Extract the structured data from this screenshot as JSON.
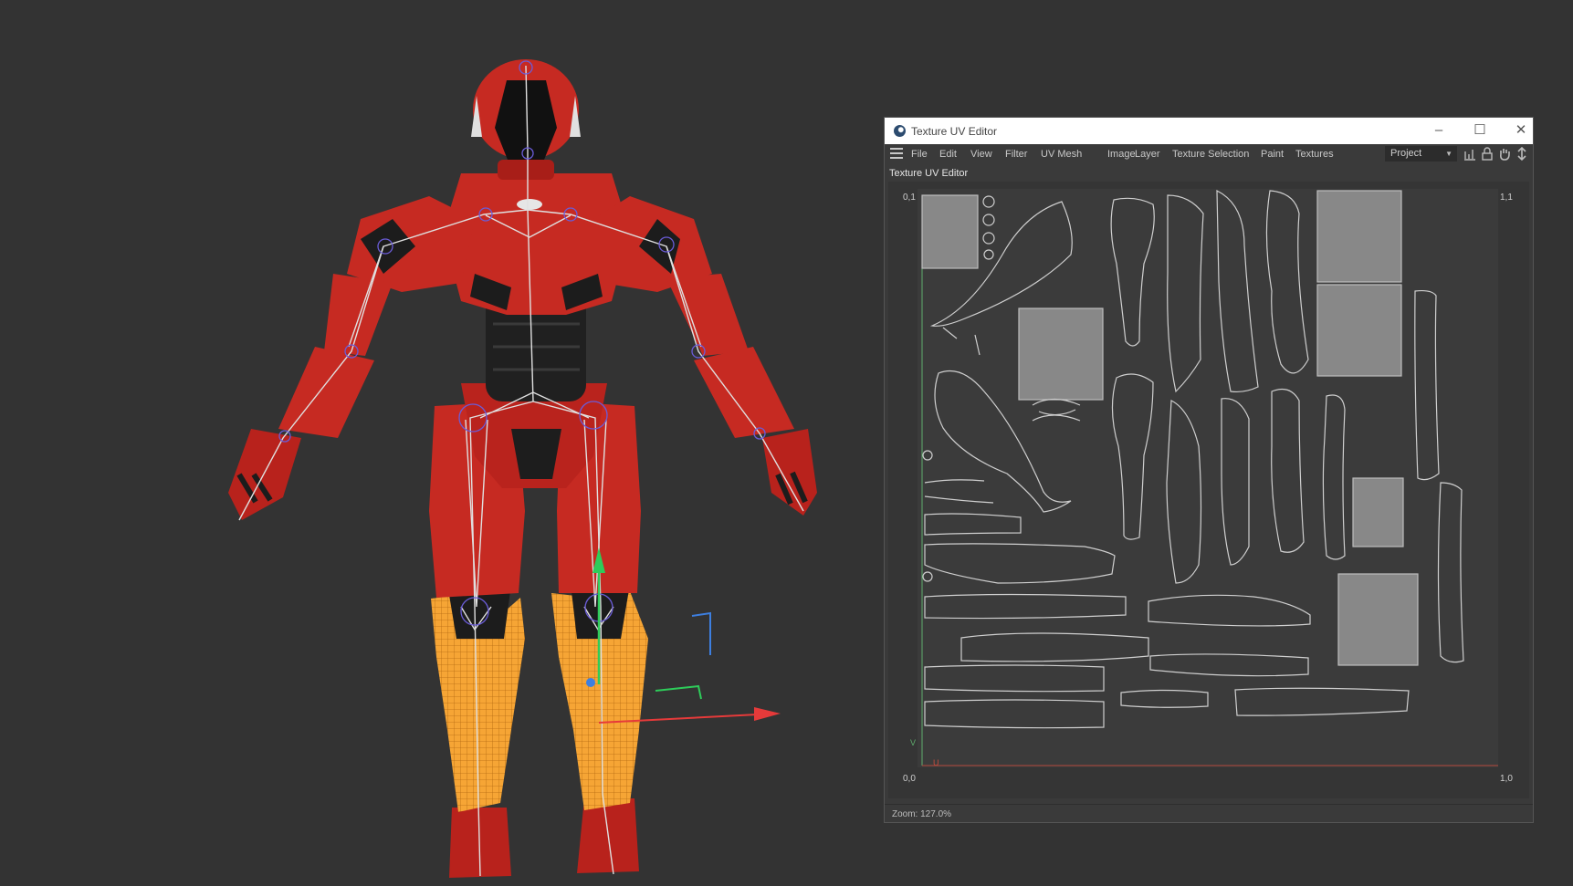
{
  "window": {
    "title": "Texture UV Editor",
    "controls": [
      "minimize-icon",
      "maximize-icon",
      "close-icon"
    ]
  },
  "menu": {
    "items": [
      "File",
      "Edit",
      "View",
      "Filter",
      "UV Mesh",
      "Image",
      "Layer",
      "Texture Selection",
      "Paint",
      "Textures"
    ],
    "project_select": "Project",
    "toolbar_icons": [
      "histogram-icon",
      "lock-icon",
      "hand-icon",
      "move-icon"
    ]
  },
  "panel": {
    "title": "Texture UV Editor",
    "corners": {
      "top_left": "0,1",
      "top_right": "1,1",
      "bottom_left": "0,0",
      "bottom_right": "1,0"
    },
    "axis_v": "V",
    "axis_u": "U"
  },
  "status": {
    "zoom": "Zoom: 127.0%"
  },
  "colors": {
    "background": "#333333",
    "armor_red": "#c62a22",
    "armor_dark": "#1c1c1c",
    "selection_orange": "#f4a236",
    "skeleton": "#e0e0e0",
    "gizmo_x": "#e63a3a",
    "gizmo_y": "#2ecc5a",
    "gizmo_z": "#3d7fe0",
    "uv_wire": "#cfcfcf"
  }
}
